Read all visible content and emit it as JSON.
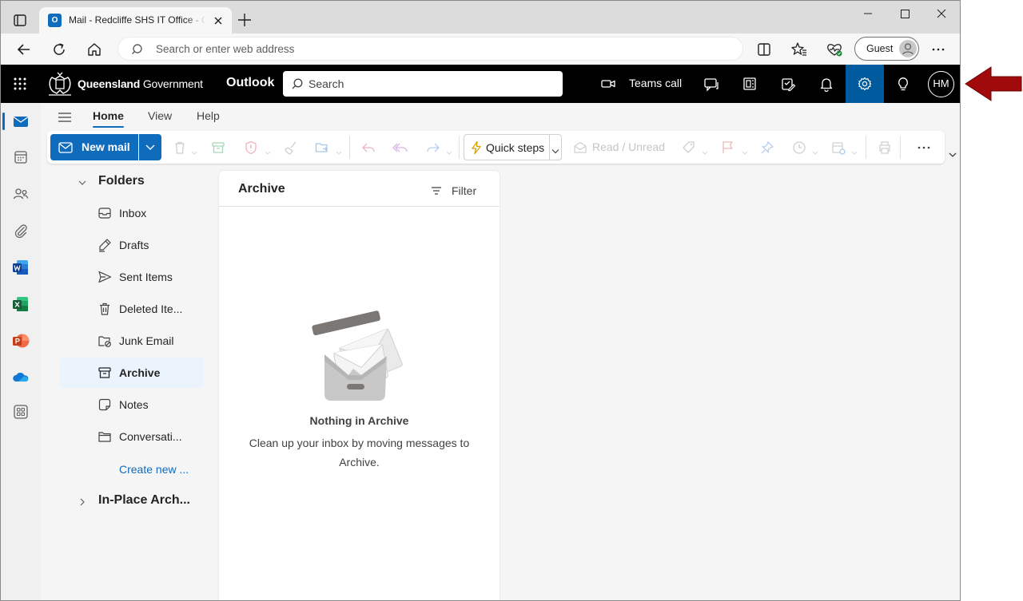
{
  "browser": {
    "tab_title": "Mail - Redcliffe SHS IT Office - Outlook",
    "address_placeholder": "Search or enter web address",
    "profile_label": "Guest"
  },
  "header": {
    "brand_bold": "Queensland",
    "brand_rest": " Government",
    "app_name": "Outlook",
    "search_placeholder": "Search",
    "teams_call_label": "Teams call",
    "avatar_initials": "HM"
  },
  "ribbon": {
    "tabs": [
      "Home",
      "View",
      "Help"
    ],
    "active_tab": "Home",
    "new_mail_label": "New mail",
    "quick_steps_label": "Quick steps",
    "read_unread_label": "Read / Unread"
  },
  "folders": {
    "header": "Folders",
    "items": [
      {
        "label": "Inbox",
        "icon": "inbox-icon"
      },
      {
        "label": "Drafts",
        "icon": "drafts-icon"
      },
      {
        "label": "Sent Items",
        "icon": "sent-icon"
      },
      {
        "label": "Deleted Ite...",
        "icon": "trash-icon"
      },
      {
        "label": "Junk Email",
        "icon": "junk-icon"
      },
      {
        "label": "Archive",
        "icon": "archive-icon",
        "selected": true
      },
      {
        "label": "Notes",
        "icon": "notes-icon"
      },
      {
        "label": "Conversati...",
        "icon": "folder-icon"
      }
    ],
    "create_new": "Create new ...",
    "in_place": "In-Place Arch..."
  },
  "message_list": {
    "title": "Archive",
    "filter_label": "Filter",
    "empty_title": "Nothing in Archive",
    "empty_desc": "Clean up your inbox by moving messages to Archive."
  },
  "colors": {
    "accent": "#0f6cbd",
    "header_bg": "#000000",
    "settings_active": "#005a9e",
    "annotation_arrow": "#a00a0a"
  }
}
